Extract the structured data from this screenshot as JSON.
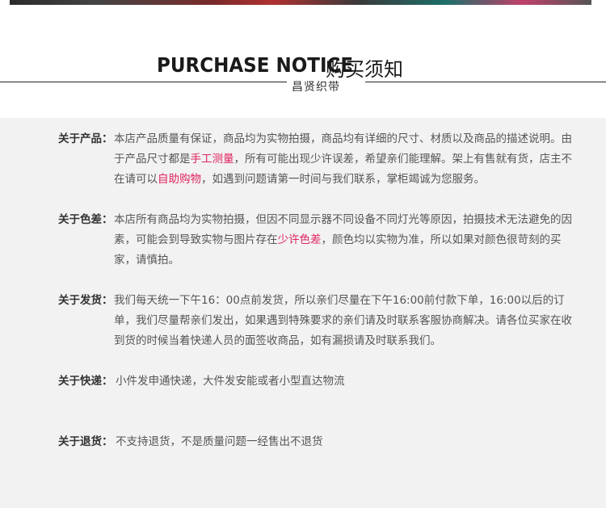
{
  "header": {
    "title_en": "PURCHASE NOTICE",
    "title_cn": "购买须知",
    "subtitle": "昌贤织带"
  },
  "sections": {
    "product": {
      "label": "关于产品：",
      "t1": "本店产品质量有保证，商品均为实物拍摄，商品均有详细的尺寸、材质以及商品的描述说明。由于产品尺寸都是",
      "hl1": "手工测量",
      "t2": "，所有可能出现少许误差，希望亲们能理解。架上有售就有货，店主不在请可以",
      "hl2": "自助购物",
      "t3": "，如遇到问题请第一时间与我们联系，掌柜竭诚为您服务。"
    },
    "color": {
      "label": "关于色差：",
      "t1": "本店所有商品均为实物拍摄，但因不同显示器不同设备不同灯光等原因，拍摄技术无法避免的因素，可能会到导致实物与图片存在",
      "hl1": "少许色差",
      "t2": "，颜色均以实物为准，所以如果对颜色很苛刻的买家，请慎拍。"
    },
    "shipping": {
      "label": "关于发货：",
      "t1": "我们每天统一下午16：00点前发货，所以亲们尽量在下午16:00前付款下单，16:00以后的订单，我们尽量帮亲们发出，如果遇到特殊要求的亲们请及时联系客服协商解决。请各位买家在收到货的时候当着快递人员的面签收商品，如有漏损请及时联系我们。"
    },
    "courier": {
      "label": "关于快递：",
      "t1": "小件发申通快递，大件发安能或者小型直达物流"
    },
    "returns": {
      "label": "关于退货：",
      "t1": "不支持退货，不是质量问题一经售出不退货"
    }
  },
  "colors": {
    "highlight": "#e0245e",
    "panel_bg": "#f2f2f2",
    "text": "#555555"
  }
}
